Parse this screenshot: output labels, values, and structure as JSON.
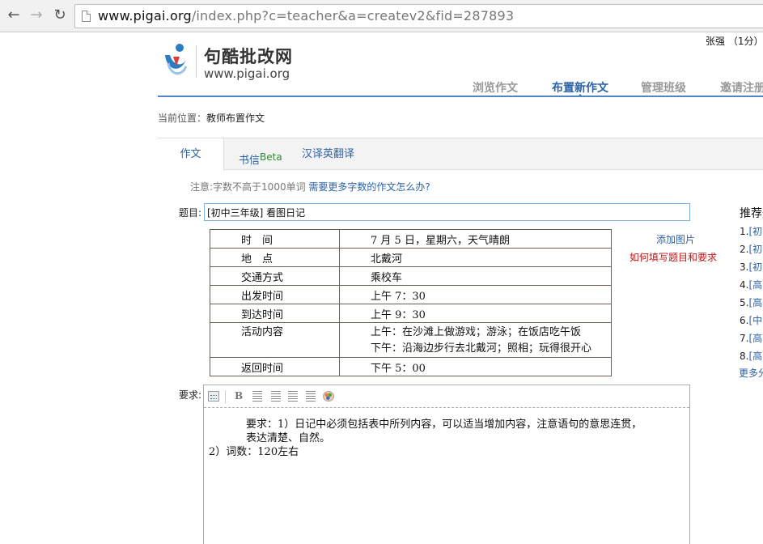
{
  "browser": {
    "url_host": "www.pigai.org",
    "url_path": "/index.php?c=teacher&a=createv2&fid=287893"
  },
  "header": {
    "user": "张强 （1分）",
    "logo_cn": "句酷批改网",
    "logo_en": "www.pigai.org",
    "nav": [
      "浏览作文",
      "布置新作文",
      "管理班级",
      "邀请注册"
    ],
    "active_nav": "布置新作文"
  },
  "breadcrumb": {
    "prefix": "当前位置：",
    "current": "教师布置作文"
  },
  "tabs": {
    "zuowen": "作文",
    "shuxin": "书信",
    "beta": "Beta",
    "fanyi": "汉译英翻译"
  },
  "note": {
    "text": "注意:字数不高于1000单词",
    "link": "需要更多字数的作文怎么办?"
  },
  "form": {
    "title_label": "题目:",
    "title_value": "[初中三年级] 看图日记",
    "req_label": "要求:"
  },
  "info_table": [
    {
      "key": "时　间",
      "value": "7 月 5 日，星期六，天气晴朗"
    },
    {
      "key": "地　点",
      "value": "北戴河"
    },
    {
      "key": "交通方式",
      "value": "乘校车"
    },
    {
      "key": "出发时间",
      "value": "上午 7：30"
    },
    {
      "key": "到达时间",
      "value": "上午 9：30"
    },
    {
      "key": "活动内容",
      "value": "上午：在沙滩上做游戏；游泳；在饭店吃午饭",
      "value2": "下午：沿海边步行去北戴河；照相；玩得很开心"
    },
    {
      "key": "返回时间",
      "value": "下午 5：00"
    }
  ],
  "side_links": {
    "add_image": "添加图片",
    "how_to": "如何填写题目和要求"
  },
  "recommend": {
    "title": "推荐题",
    "items": [
      {
        "num": "1.",
        "text": "[初"
      },
      {
        "num": "2.",
        "text": "[初"
      },
      {
        "num": "3.",
        "text": "[初"
      },
      {
        "num": "4.",
        "text": "[高"
      },
      {
        "num": "5.",
        "text": "[高"
      },
      {
        "num": "6.",
        "text": "[中"
      },
      {
        "num": "7.",
        "text": "[高"
      },
      {
        "num": "8.",
        "text": "[高"
      }
    ],
    "more": "更多分"
  },
  "editor": {
    "line1": "要求：1）日记中必须包括表中所列内容，可以适当增加内容，注意语句的意思连贯，",
    "line2": "表达清楚、自然。",
    "line3": "2）词数：120左右"
  }
}
